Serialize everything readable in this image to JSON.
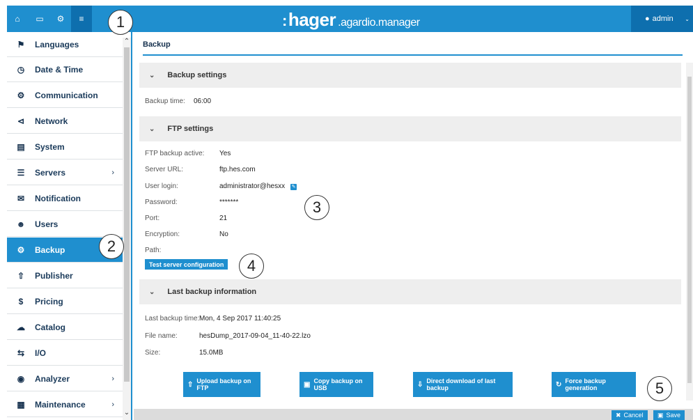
{
  "topbar": {
    "nav_icons": [
      "home-icon",
      "monitor-icon",
      "gears-icon",
      "sliders-icon"
    ],
    "brand": "hager",
    "brand_suffix": ".agardio.manager",
    "user": "admin"
  },
  "callouts": [
    "1",
    "2",
    "3",
    "4",
    "5"
  ],
  "sidebar": {
    "items": [
      {
        "label": "Languages",
        "icon": "flag-icon"
      },
      {
        "label": "Date & Time",
        "icon": "clock-icon"
      },
      {
        "label": "Communication",
        "icon": "gears-icon"
      },
      {
        "label": "Network",
        "icon": "share-icon"
      },
      {
        "label": "System",
        "icon": "hdd-icon"
      },
      {
        "label": "Servers",
        "icon": "server-icon",
        "arrow": "›"
      },
      {
        "label": "Notification",
        "icon": "envelope-icon"
      },
      {
        "label": "Users",
        "icon": "users-icon"
      },
      {
        "label": "Backup",
        "icon": "gears-icon",
        "active": true
      },
      {
        "label": "Publisher",
        "icon": "upload-icon"
      },
      {
        "label": "Pricing",
        "icon": "dollar-icon"
      },
      {
        "label": "Catalog",
        "icon": "cloud-icon"
      },
      {
        "label": "I/O",
        "icon": "exchange-icon"
      },
      {
        "label": "Analyzer",
        "icon": "eye-icon",
        "arrow": "›"
      },
      {
        "label": "Maintenance",
        "icon": "medkit-icon",
        "arrow": "›"
      }
    ]
  },
  "main": {
    "title": "Backup",
    "backup_settings": {
      "title": "Backup settings",
      "backup_time_label": "Backup time:",
      "backup_time": "06:00"
    },
    "ftp_settings": {
      "title": "FTP settings",
      "rows": [
        {
          "label": "FTP backup active:",
          "value": "Yes"
        },
        {
          "label": "Server URL:",
          "value": "ftp.hes.com"
        },
        {
          "label": "User login:",
          "value": "administrator@hesxx"
        },
        {
          "label": "Password:",
          "value": "*******"
        },
        {
          "label": "Port:",
          "value": "21"
        },
        {
          "label": "Encryption:",
          "value": "No"
        },
        {
          "label": "Path:",
          "value": ""
        }
      ],
      "test_button": "Test server configuration"
    },
    "last_backup": {
      "title": "Last backup information",
      "rows": [
        {
          "label": "Last backup time:",
          "value": "Mon, 4 Sep 2017 11:40:25"
        },
        {
          "label": "File name:",
          "value": "hesDump_2017-09-04_11-40-22.lzo"
        },
        {
          "label": "Size:",
          "value": "15.0MB"
        }
      ]
    },
    "actions": {
      "upload_ftp": "Upload backup on FTP",
      "copy_usb": "Copy backup on USB",
      "direct_download": "Direct download of last backup",
      "force_generation": "Force backup generation"
    }
  },
  "footer": {
    "cancel": "Cancel",
    "save": "Save"
  }
}
